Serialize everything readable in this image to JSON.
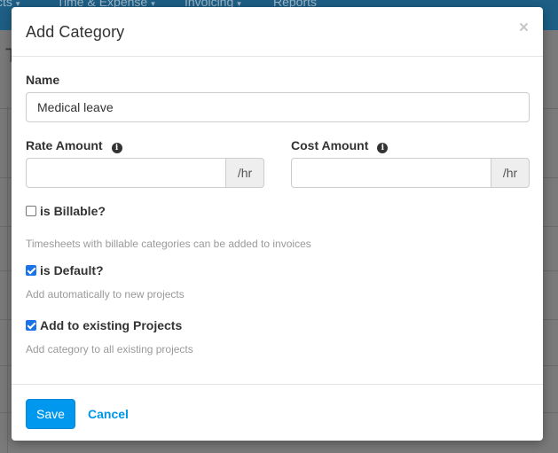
{
  "background": {
    "nav": [
      {
        "label": "cts",
        "caret": "▾"
      },
      {
        "label": "Time & Expense",
        "caret": "▾"
      },
      {
        "label": "Invoicing",
        "caret": "▾"
      },
      {
        "label": "Reports",
        "caret": ""
      }
    ],
    "heading": "T"
  },
  "modal": {
    "title": "Add Category",
    "close_glyph": "×",
    "name": {
      "label": "Name",
      "value": "Medical leave"
    },
    "rate": {
      "label": "Rate Amount",
      "value": "",
      "addon": "/hr",
      "info_glyph": "i"
    },
    "cost": {
      "label": "Cost Amount",
      "value": "",
      "addon": "/hr",
      "info_glyph": "i"
    },
    "billable": {
      "label": "is Billable?",
      "checked": false,
      "help": "Timesheets with billable categories can be added to invoices"
    },
    "default": {
      "label": "is Default?",
      "checked": true,
      "help": "Add automatically to new projects"
    },
    "existing": {
      "label": "Add to existing Projects",
      "checked": true,
      "help": "Add category to all existing projects"
    },
    "save_label": "Save",
    "cancel_label": "Cancel"
  },
  "colors": {
    "primary": "#0098ef",
    "link": "#0095e8",
    "checkbox": "#1a73e8",
    "nav_bg": "#1e5f86"
  }
}
